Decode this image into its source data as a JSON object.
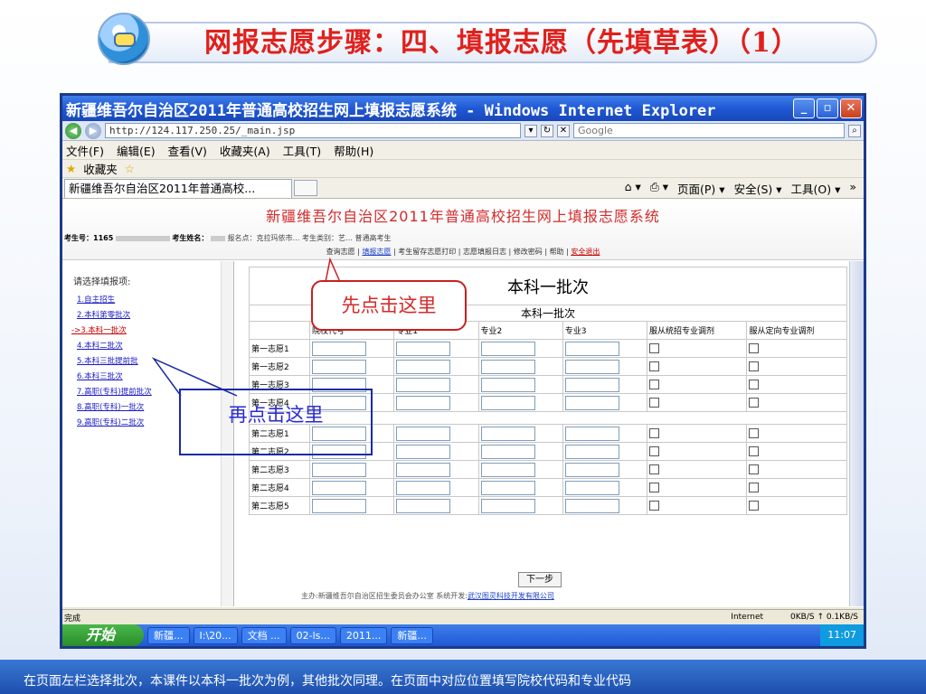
{
  "slide": {
    "title": "网报志愿步骤：四、填报志愿（先填草表）（1）",
    "caption": "在页面左栏选择批次，本课件以本科一批次为例，其他批次同理。在页面中对应位置填写院校代码和专业代码",
    "callout_1": "先点击这里",
    "callout_2": "再点击这里"
  },
  "window": {
    "title": "新疆维吾尔自治区2011年普通高校招生网上填报志愿系统 - Windows Internet Explorer",
    "address": "http://124.117.250.25/_main.jsp",
    "search": "Google",
    "menu": [
      "文件(F)",
      "编辑(E)",
      "查看(V)",
      "收藏夹(A)",
      "工具(T)",
      "帮助(H)"
    ],
    "favorites": "收藏夹",
    "tab_title": "新疆维吾尔自治区2011年普通高校...",
    "cmd": [
      "页面(P) ▾",
      "安全(S) ▾",
      "工具(O) ▾",
      "»"
    ],
    "status": "完成",
    "zone": "Internet",
    "speed": "0KB/S  ↑ 0.1KB/S"
  },
  "page": {
    "system_title": "新疆维吾尔自治区2011年普通高校招生网上填报志愿系统",
    "exam_no_label": "考生号：",
    "exam_no": "1165",
    "name_label": "考生姓名：",
    "info_tail": "报名点：克拉玛依市… 考生类别：艺… 普通高考生",
    "nav": [
      "查询志愿",
      "填报志愿",
      "考生留存志愿打印",
      "志愿填报日志",
      "修改密码",
      "帮助",
      "安全退出"
    ],
    "left_title": "请选择填报项:",
    "batches": [
      "1.自主招生",
      "2.本科第零批次",
      "->3.本科一批次",
      "4.本科二批次",
      "5.本科三批提前批",
      "6.本科三批次",
      "7.高职(专科)提前批次",
      "8.高职(专科)一批次",
      "9.高职(专科)二批次"
    ],
    "form_title": "本科一批次",
    "form_subtitle": "本科一批次",
    "columns": [
      "院校代号",
      "专业1",
      "专业2",
      "专业3",
      "服从统招专业调剂",
      "服从定向专业调剂"
    ],
    "rows_first": [
      "第一志愿1",
      "第一志愿2",
      "第一志愿3",
      "第一志愿4"
    ],
    "rows_second": [
      "第二志愿1",
      "第二志愿2",
      "第二志愿3",
      "第二志愿4",
      "第二志愿5"
    ],
    "next_button": "下一步",
    "footer_left": "主办:新疆维吾尔自治区招生委员会办公室   系统开发:",
    "footer_company": "武汉图灵科技开发有限公司"
  },
  "taskbar": {
    "start": "开始",
    "tasks": [
      "新疆...",
      "I:\\20...",
      "文档 ...",
      "02-ls...",
      "2011...",
      "新疆..."
    ],
    "clock": "11:07"
  }
}
